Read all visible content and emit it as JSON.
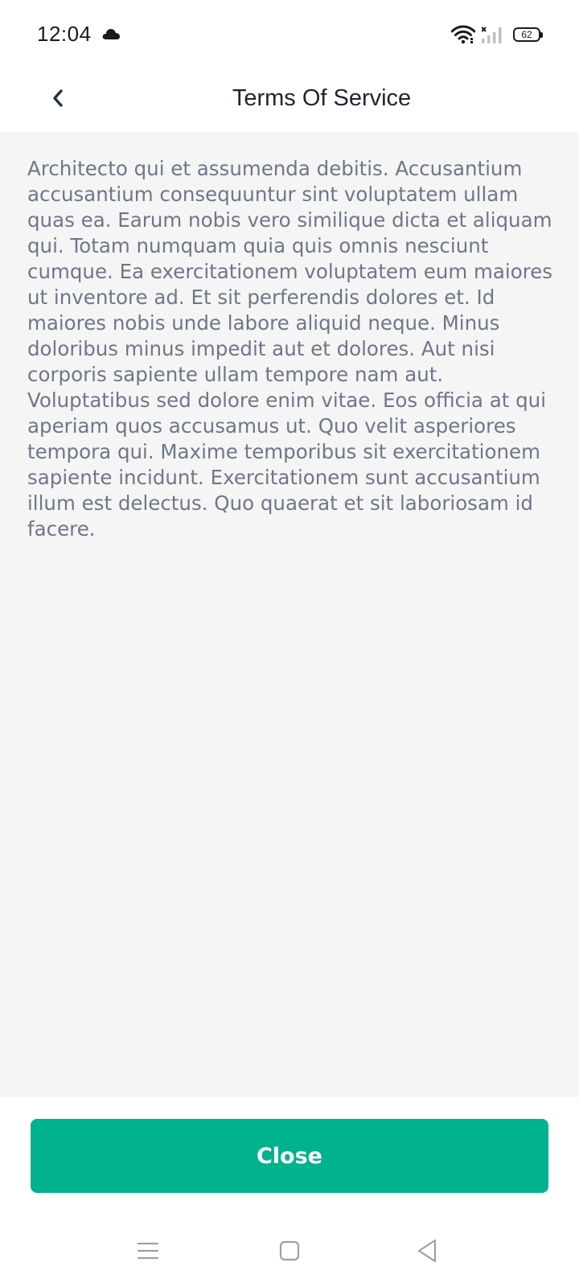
{
  "status_bar": {
    "time": "12:04",
    "battery_level": "62",
    "icons": [
      "cloud-icon",
      "wifi-icon",
      "cellular-signal-icon",
      "battery-icon"
    ]
  },
  "header": {
    "title": "Terms Of Service",
    "back_icon": "chevron-left-icon"
  },
  "content": {
    "terms_text": "Architecto qui et assumenda debitis. Accusantium accusantium consequuntur sint voluptatem ullam quas ea. Earum nobis vero similique dicta et aliquam qui. Totam numquam quia quis omnis nesciunt cumque. Ea exercitationem voluptatem eum maiores ut inventore ad. Et sit perferendis dolores et. Id maiores nobis unde labore aliquid neque. Minus doloribus minus impedit aut et dolores. Aut nisi corporis sapiente ullam tempore nam aut. Voluptatibus sed dolore enim vitae. Eos officia at qui aperiam quos accusamus ut. Quo velit asperiores tempora qui. Maxime temporibus sit exercitationem sapiente incidunt. Exercitationem sunt accusantium illum est delectus. Quo quaerat et sit laboriosam id facere."
  },
  "footer": {
    "close_label": "Close"
  },
  "nav_bar": {
    "icons": [
      "menu-icon",
      "home-square-icon",
      "back-triangle-icon"
    ]
  },
  "colors": {
    "accent": "#00b38e",
    "body_text": "#6e7787",
    "content_background": "#f5f5f5"
  }
}
